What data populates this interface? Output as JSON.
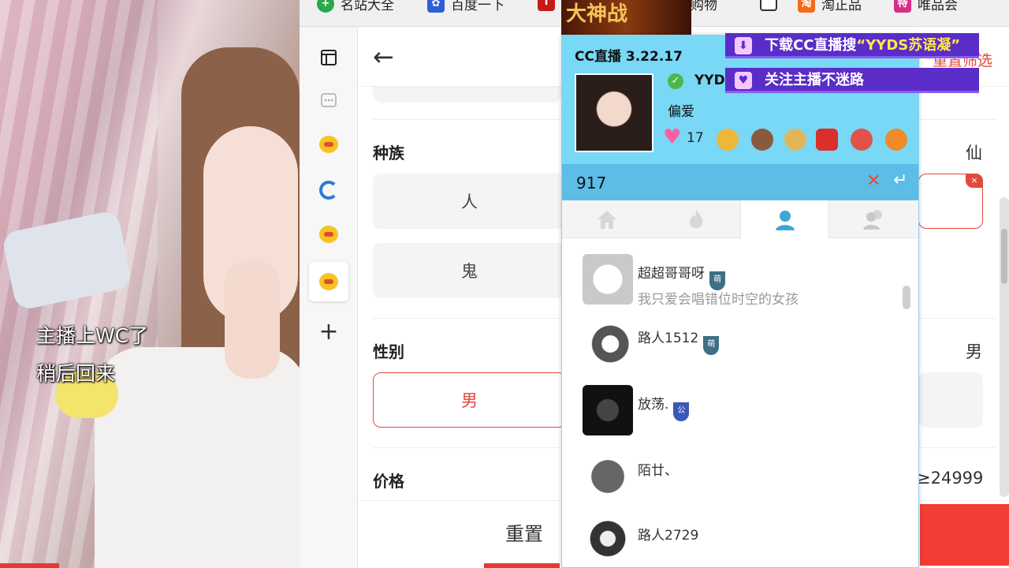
{
  "stream": {
    "notice_line1": "主播上WC了",
    "notice_line2": "稍后回来"
  },
  "bookmarks": [
    {
      "label": "名站大全",
      "icon": "plus-icon",
      "color": "#2aa84a"
    },
    {
      "label": "百度一下",
      "icon": "baidu-paw-icon",
      "color": "#2f5fd8"
    },
    {
      "label": "购物",
      "icon": "shopping-icon",
      "color": "#c51a1a"
    },
    {
      "label": "淘正品",
      "icon": "taobao-icon",
      "color": "#f56a1a"
    },
    {
      "label": "唯品会",
      "icon": "vip-icon",
      "color": "#d62e86"
    }
  ],
  "filter_panel": {
    "reset_filter_label": "重置筛选",
    "sections": {
      "race_label": "种族",
      "race_selected_value": "仙",
      "race_options": [
        "人",
        "鬼"
      ],
      "gender_label": "性别",
      "gender_selected_value": "男",
      "gender_option": "男",
      "price_label": "价格",
      "price_value": "≥24999"
    },
    "reset_button": "重置"
  },
  "cc_overlay": {
    "title": "CC直播 3.22.17",
    "user_id": "YYDS",
    "nickname": "偏爱",
    "heart_count": "17",
    "search_value": "917",
    "promo1_prefix": "下载CC直播搜",
    "promo1_highlight": "“YYDS苏语凝”",
    "promo2": "关注主播不迷路",
    "banner_text": "大神战",
    "viewers": [
      {
        "name": "超超哥哥呀",
        "signature": "我只爱会唱错位时空的女孩",
        "badge": "萌"
      },
      {
        "name": "路人1512",
        "signature": "",
        "badge": "萌"
      },
      {
        "name": "放荡.",
        "signature": "",
        "badge": "公"
      },
      {
        "name": "陌廿、",
        "signature": "",
        "badge": ""
      },
      {
        "name": "路人2729",
        "signature": "",
        "badge": ""
      }
    ]
  }
}
